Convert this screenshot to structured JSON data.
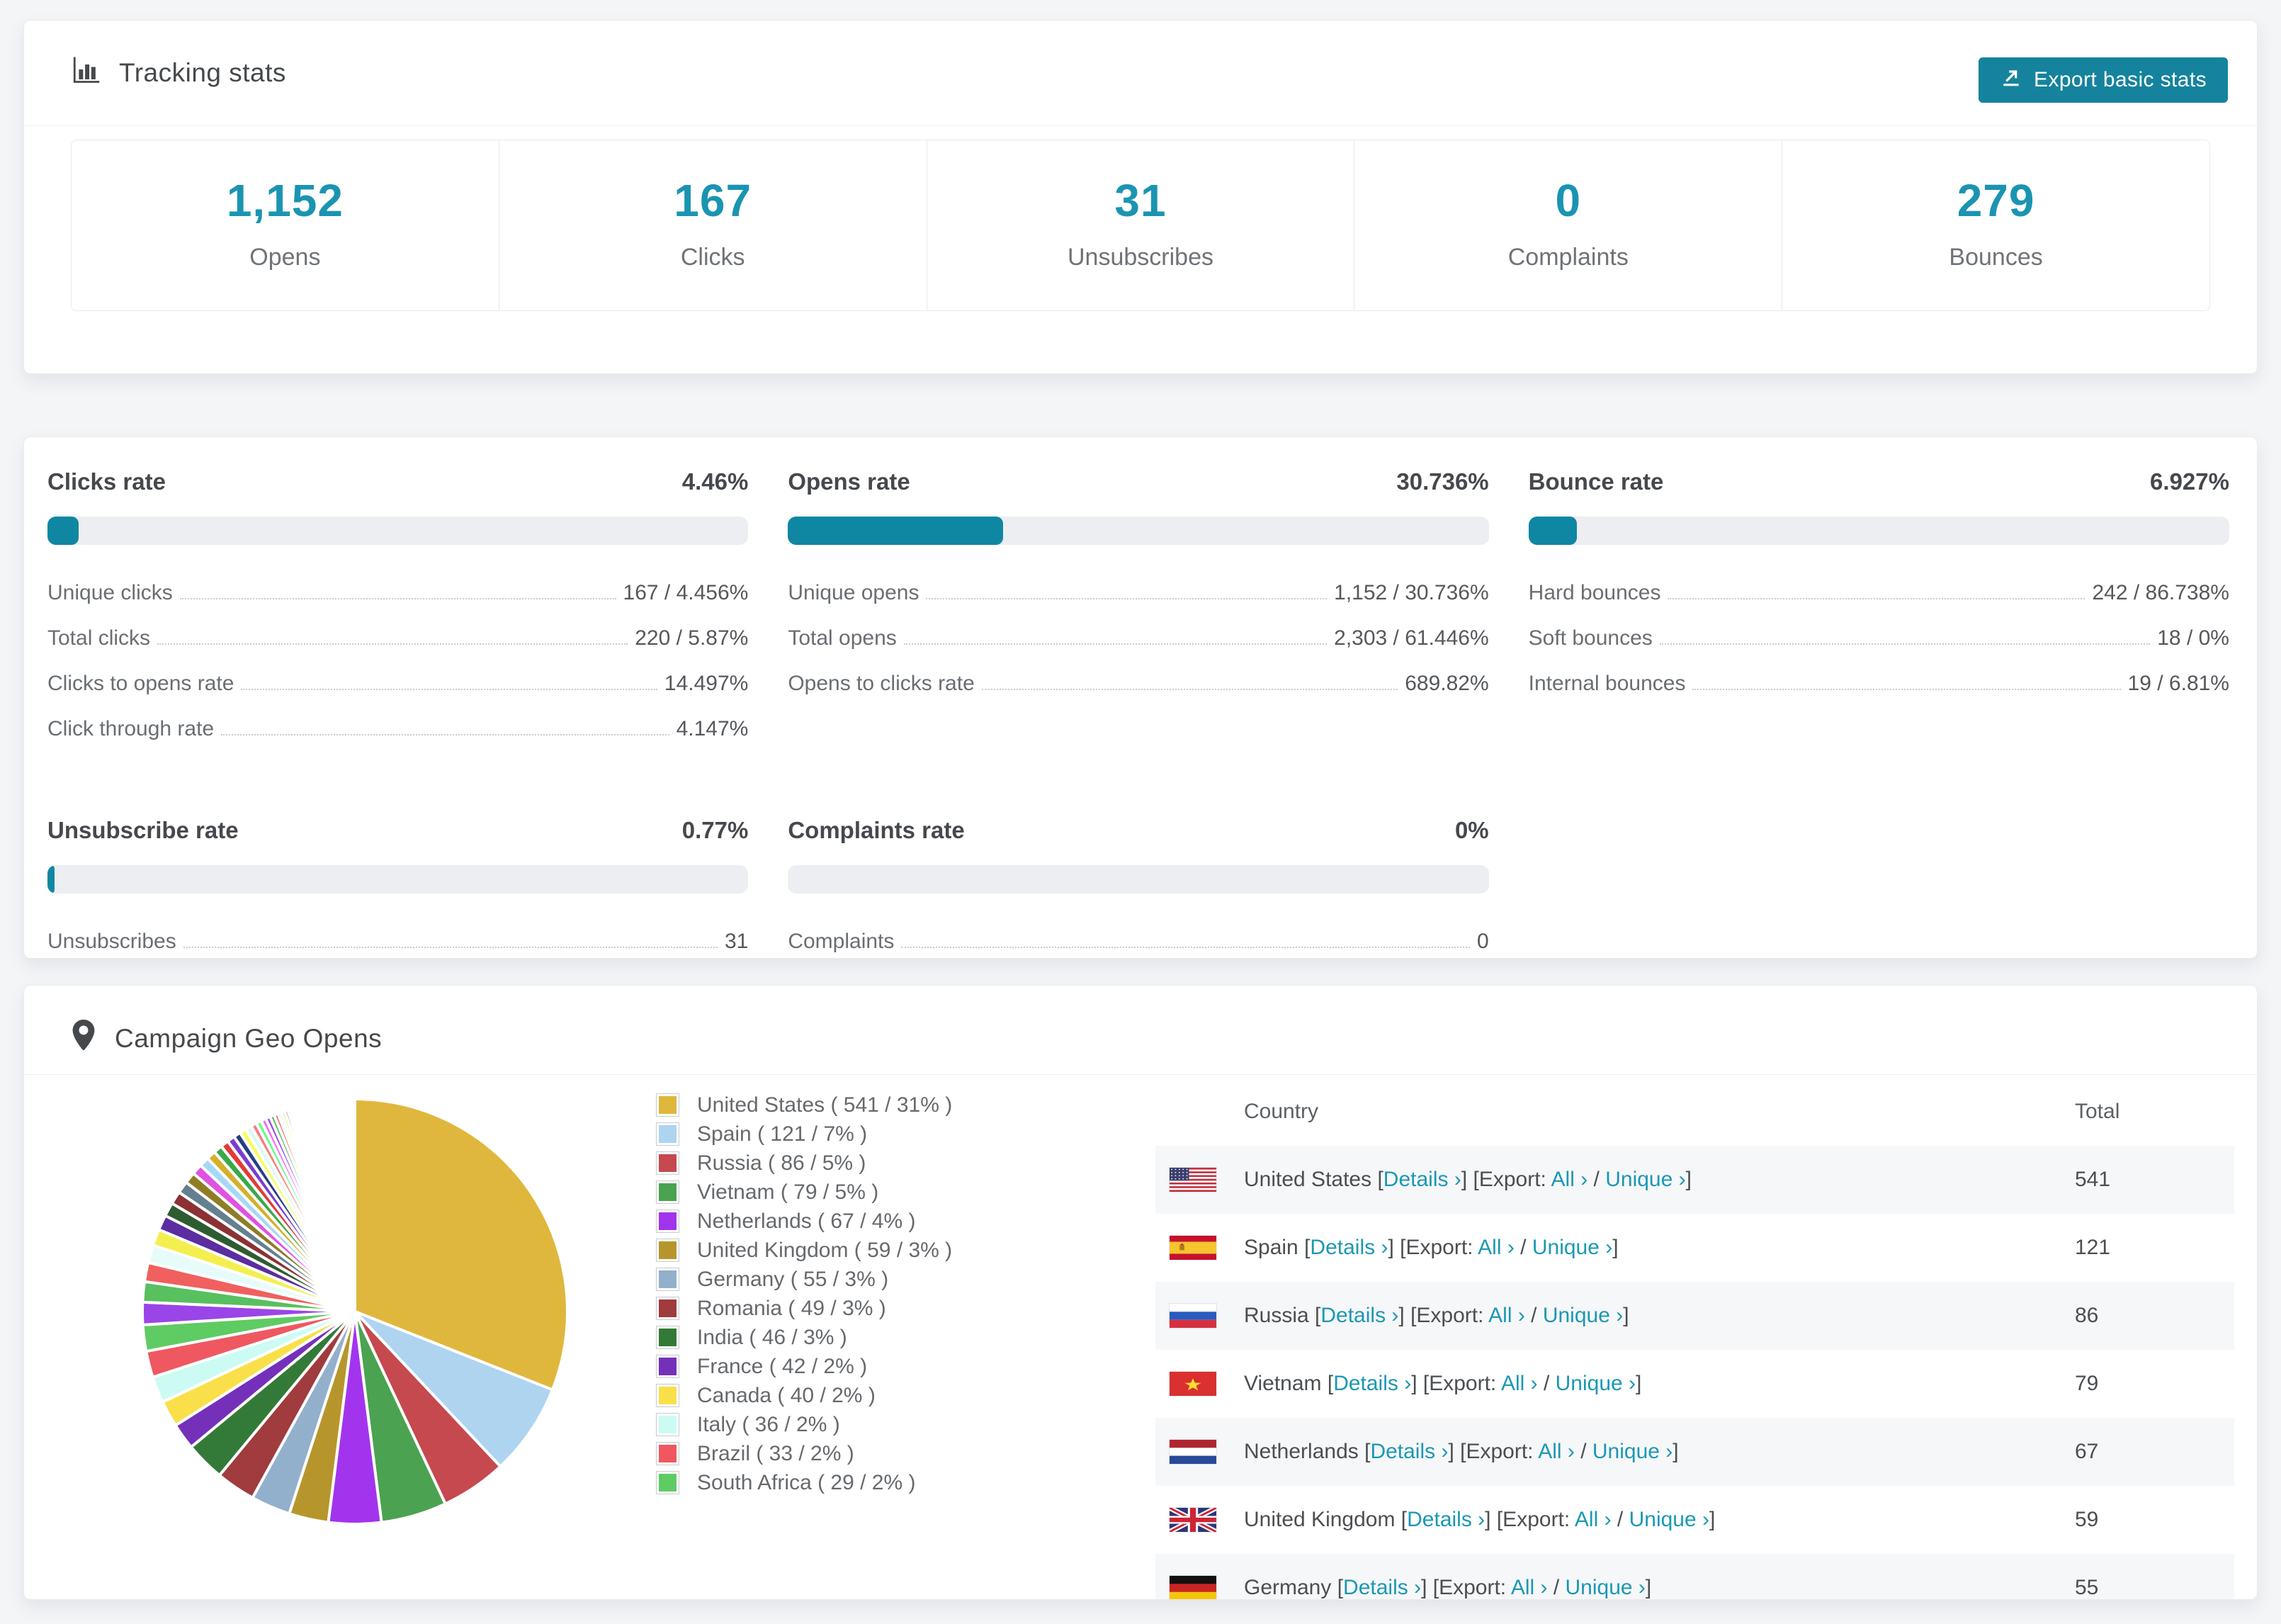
{
  "tracking": {
    "title": "Tracking stats",
    "export_button": "Export basic stats",
    "stats": [
      {
        "value": "1,152",
        "label": "Opens"
      },
      {
        "value": "167",
        "label": "Clicks"
      },
      {
        "value": "31",
        "label": "Unsubscribes"
      },
      {
        "value": "0",
        "label": "Complaints"
      },
      {
        "value": "279",
        "label": "Bounces"
      }
    ]
  },
  "rates": [
    {
      "title": "Clicks rate",
      "value": "4.46%",
      "pct": 4.46,
      "rows": [
        [
          "Unique clicks",
          "167 / 4.456%"
        ],
        [
          "Total clicks",
          "220 / 5.87%"
        ],
        [
          "Clicks to opens rate",
          "14.497%"
        ],
        [
          "Click through rate",
          "4.147%"
        ]
      ]
    },
    {
      "title": "Opens rate",
      "value": "30.736%",
      "pct": 30.736,
      "rows": [
        [
          "Unique opens",
          "1,152 / 30.736%"
        ],
        [
          "Total opens",
          "2,303 / 61.446%"
        ],
        [
          "Opens to clicks rate",
          "689.82%"
        ]
      ]
    },
    {
      "title": "Bounce rate",
      "value": "6.927%",
      "pct": 6.927,
      "rows": [
        [
          "Hard bounces",
          "242 / 86.738%"
        ],
        [
          "Soft bounces",
          "18 / 0%"
        ],
        [
          "Internal bounces",
          "19 / 6.81%"
        ]
      ]
    },
    {
      "title": "Unsubscribe rate",
      "value": "0.77%",
      "pct": 0.77,
      "rows": [
        [
          "Unsubscribes",
          "31"
        ]
      ]
    },
    {
      "title": "Complaints rate",
      "value": "0%",
      "pct": 0,
      "rows": [
        [
          "Complaints",
          "0"
        ]
      ]
    }
  ],
  "geo": {
    "title": "Campaign Geo Opens",
    "chart_data": {
      "type": "pie",
      "title": "Campaign Geo Opens",
      "start_angle_deg": -90,
      "direction": "clockwise",
      "slices": [
        {
          "label": "United States",
          "opens": 541,
          "pct": 31,
          "color": "#e0b73d"
        },
        {
          "label": "Spain",
          "opens": 121,
          "pct": 7,
          "color": "#aed4f0"
        },
        {
          "label": "Russia",
          "opens": 86,
          "pct": 5,
          "color": "#c5494f"
        },
        {
          "label": "Vietnam",
          "opens": 79,
          "pct": 5,
          "color": "#4ba251"
        },
        {
          "label": "Netherlands",
          "opens": 67,
          "pct": 4,
          "color": "#a234ee"
        },
        {
          "label": "United Kingdom",
          "opens": 59,
          "pct": 3,
          "color": "#b6962c"
        },
        {
          "label": "Germany",
          "opens": 55,
          "pct": 3,
          "color": "#92b0cc"
        },
        {
          "label": "Romania",
          "opens": 49,
          "pct": 3,
          "color": "#a03b3e"
        },
        {
          "label": "India",
          "opens": 46,
          "pct": 3,
          "color": "#337a38"
        },
        {
          "label": "France",
          "opens": 42,
          "pct": 2,
          "color": "#7530ba"
        },
        {
          "label": "Canada",
          "opens": 40,
          "pct": 2,
          "color": "#f9e04a"
        },
        {
          "label": "Italy",
          "opens": 36,
          "pct": 2,
          "color": "#ccfbf4"
        },
        {
          "label": "Brazil",
          "opens": 33,
          "pct": 2,
          "color": "#ef5860"
        },
        {
          "label": "South Africa",
          "opens": 29,
          "pct": 2,
          "color": "#5fcb63"
        }
      ],
      "other_slices_pct": [
        1.7,
        1.55,
        1.45,
        1.35,
        1.25,
        1.15,
        1.05,
        0.98,
        0.92,
        0.86,
        0.8,
        0.75,
        0.7,
        0.66,
        0.62,
        0.58,
        0.54,
        0.5,
        0.47,
        0.44,
        0.41,
        0.38,
        0.35,
        0.33,
        0.3,
        0.28,
        0.26,
        0.24,
        0.22,
        0.2,
        0.18,
        0.17,
        0.15,
        0.14,
        0.13,
        0.12,
        0.11,
        0.1,
        0.09,
        0.08,
        0.07,
        0.06,
        0.06,
        0.05,
        0.05,
        0.04
      ],
      "other_palette": [
        "#9a45e8",
        "#58c05e",
        "#f0605f",
        "#e8fbfb",
        "#f4ef4f",
        "#5a2da0",
        "#2e5c31",
        "#8c3134",
        "#64808f",
        "#8f7d26",
        "#e052e0",
        "#a7d7f7",
        "#d4b02c",
        "#39a94b",
        "#e23b3b",
        "#7b3bd4",
        "#243f85",
        "#f5fd60",
        "#d9f9f2",
        "#fa7d7d",
        "#68fa8a",
        "#fa68fa"
      ]
    },
    "legend_format": {
      "open": "( ",
      "sep": " / ",
      "close": "% )"
    },
    "table": {
      "columns": [
        "Country",
        "Total"
      ],
      "link_labels": {
        "details": "Details ›",
        "all": "All ›",
        "unique": "Unique ›"
      },
      "text_bits": {
        "lb": " [",
        "rb": "]",
        "export": " [Export: ",
        "slash": " / "
      },
      "rows": [
        {
          "flag": "us",
          "country": "United States",
          "total": "541"
        },
        {
          "flag": "es",
          "country": "Spain",
          "total": "121"
        },
        {
          "flag": "ru",
          "country": "Russia",
          "total": "86"
        },
        {
          "flag": "vn",
          "country": "Vietnam",
          "total": "79"
        },
        {
          "flag": "nl",
          "country": "Netherlands",
          "total": "67"
        },
        {
          "flag": "gb",
          "country": "United Kingdom",
          "total": "59"
        },
        {
          "flag": "de",
          "country": "Germany",
          "total": "55"
        }
      ]
    }
  }
}
